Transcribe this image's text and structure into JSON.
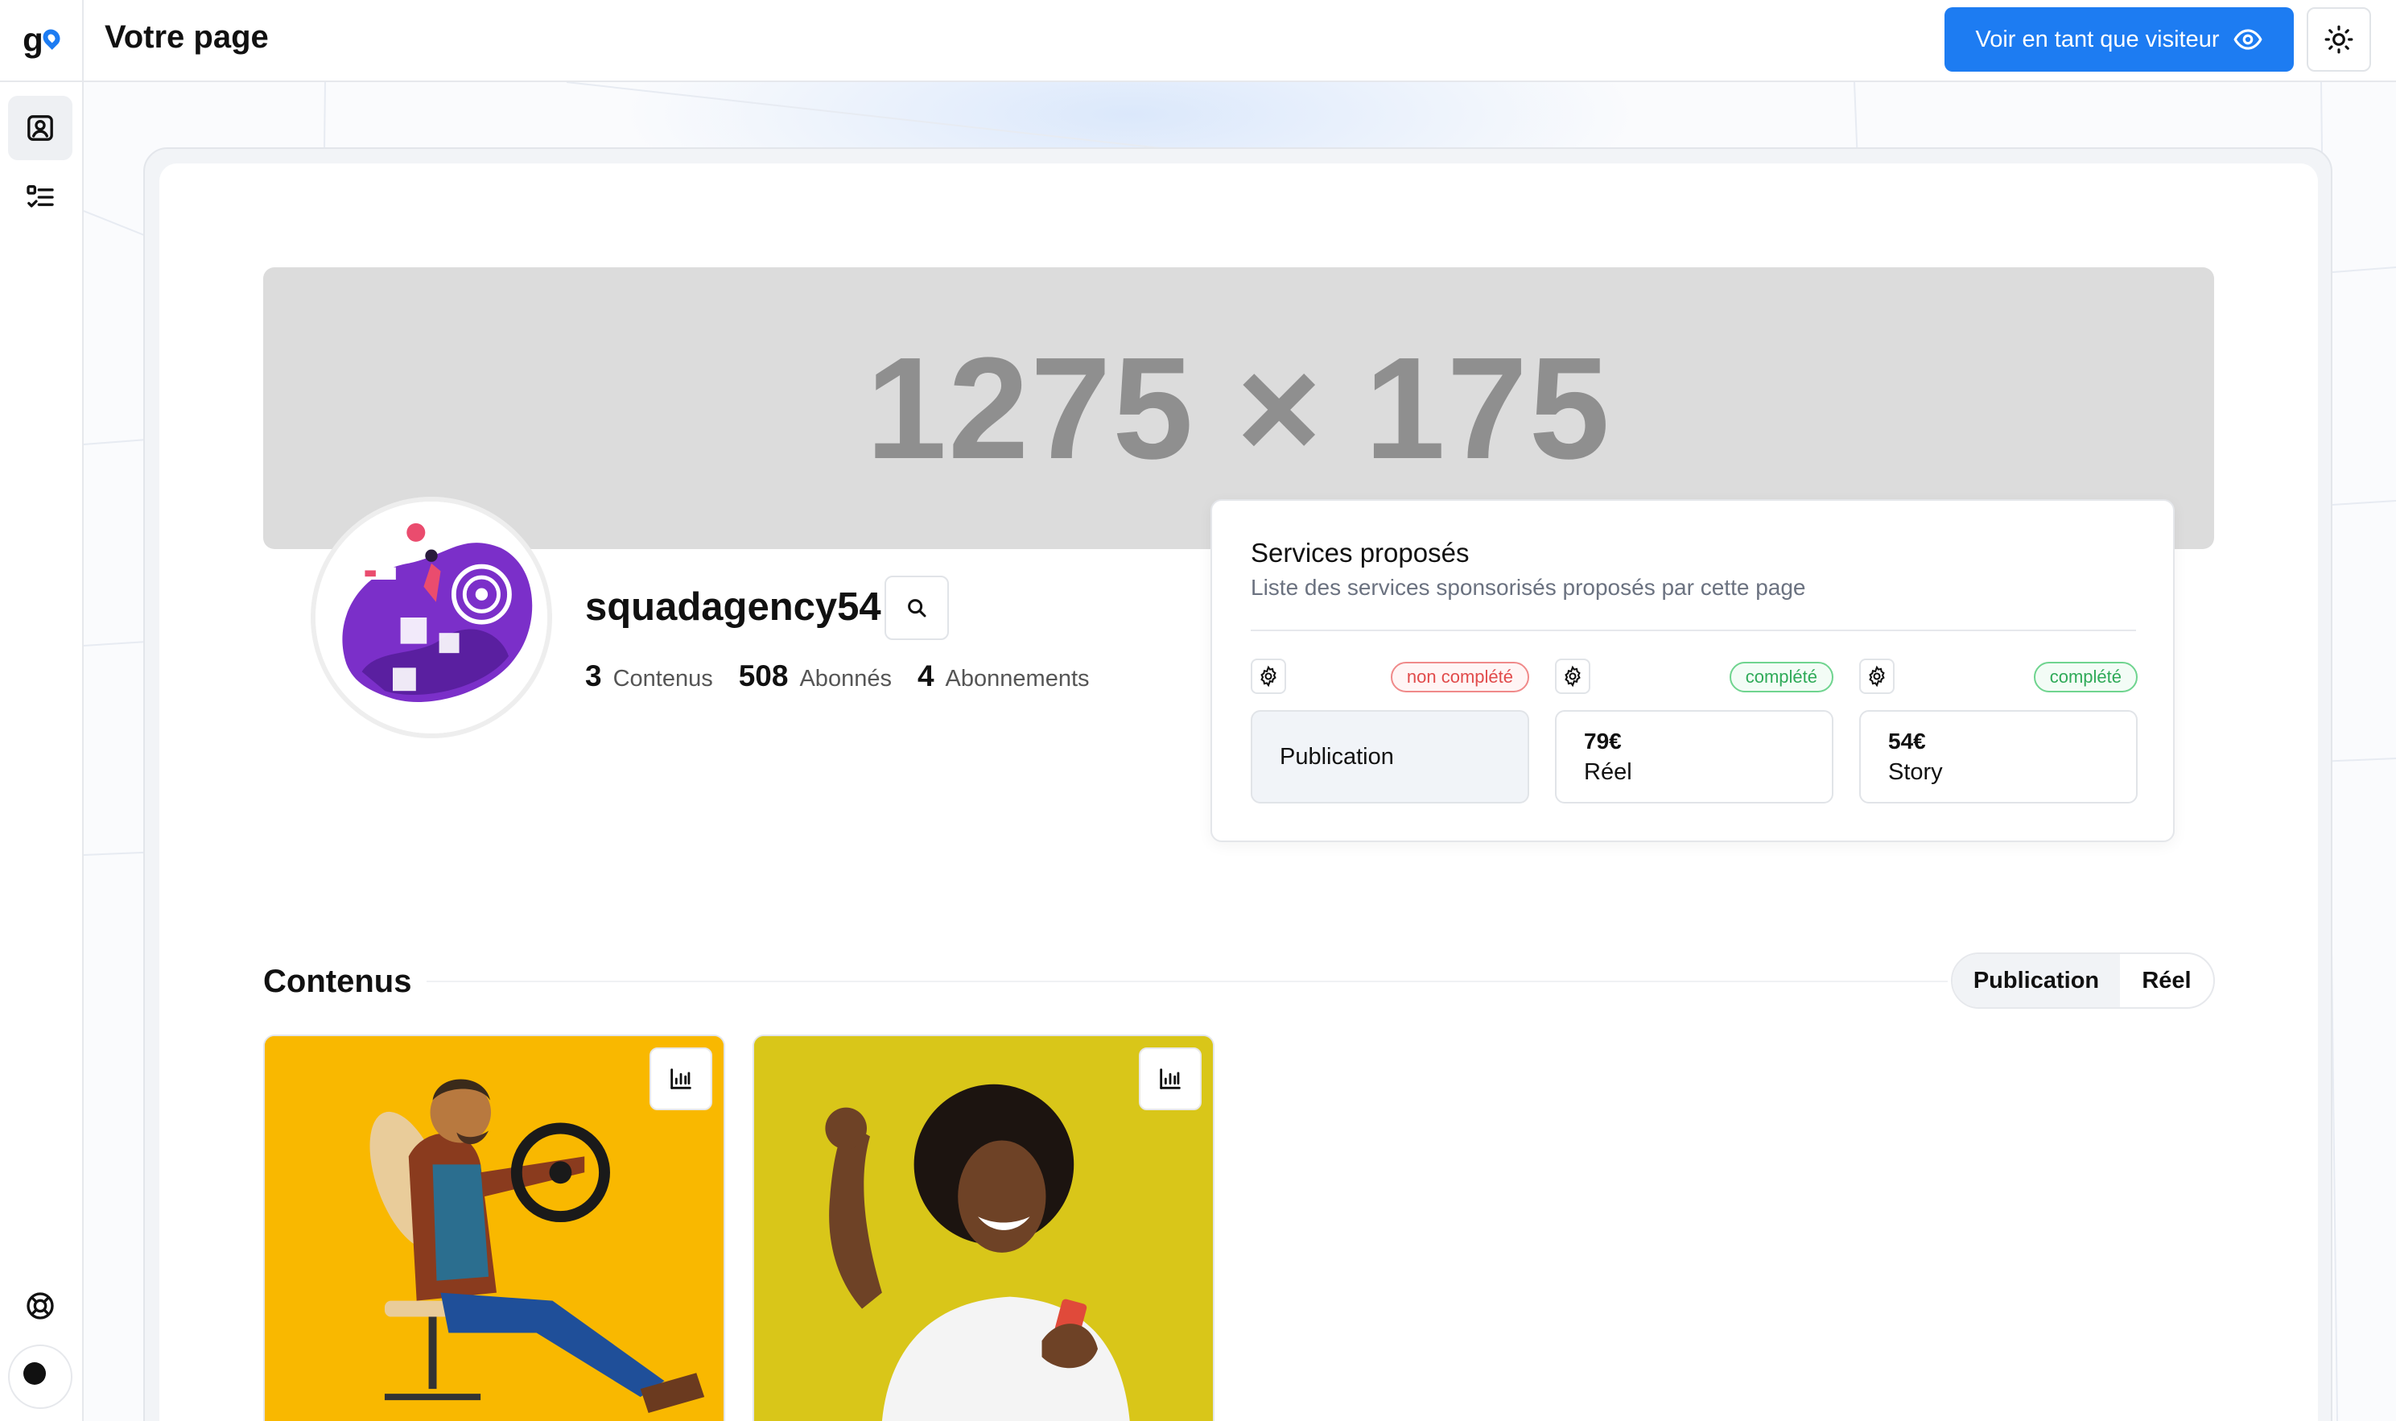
{
  "header": {
    "page_title": "Votre page",
    "visitor_button": "Voir en tant que visiteur",
    "logo": "go"
  },
  "sidebar": {
    "items": [
      {
        "icon": "profile-card-icon",
        "active": true
      },
      {
        "icon": "checklist-icon",
        "active": false
      }
    ],
    "bottom": [
      {
        "icon": "lifebuoy-icon"
      },
      {
        "icon": "user-avatar-dot"
      }
    ]
  },
  "banner": {
    "placeholder_text": "1275 × 175"
  },
  "profile": {
    "username": "squadagency54",
    "stats": [
      {
        "value": "3",
        "label": "Contenus"
      },
      {
        "value": "508",
        "label": "Abonnés"
      },
      {
        "value": "4",
        "label": "Abonnements"
      }
    ]
  },
  "services": {
    "title": "Services proposés",
    "subtitle": "Liste des services sponsorisés proposés par cette page",
    "items": [
      {
        "status": "non complété",
        "price": "",
        "name": "Publication",
        "status_color": "#e14b4b"
      },
      {
        "status": "complété",
        "price": "79€",
        "name": "Réel",
        "status_color": "#2faa58"
      },
      {
        "status": "complété",
        "price": "54€",
        "name": "Story",
        "status_color": "#2faa58"
      }
    ]
  },
  "contenus": {
    "title": "Contenus",
    "tabs": [
      "Publication",
      "Réel"
    ],
    "active_tab": "Publication"
  },
  "colors": {
    "accent": "#1d7cf2",
    "banner_bg": "#dcdcdc",
    "media1_bg": "#f9b800",
    "media2_bg": "#d9c619"
  }
}
